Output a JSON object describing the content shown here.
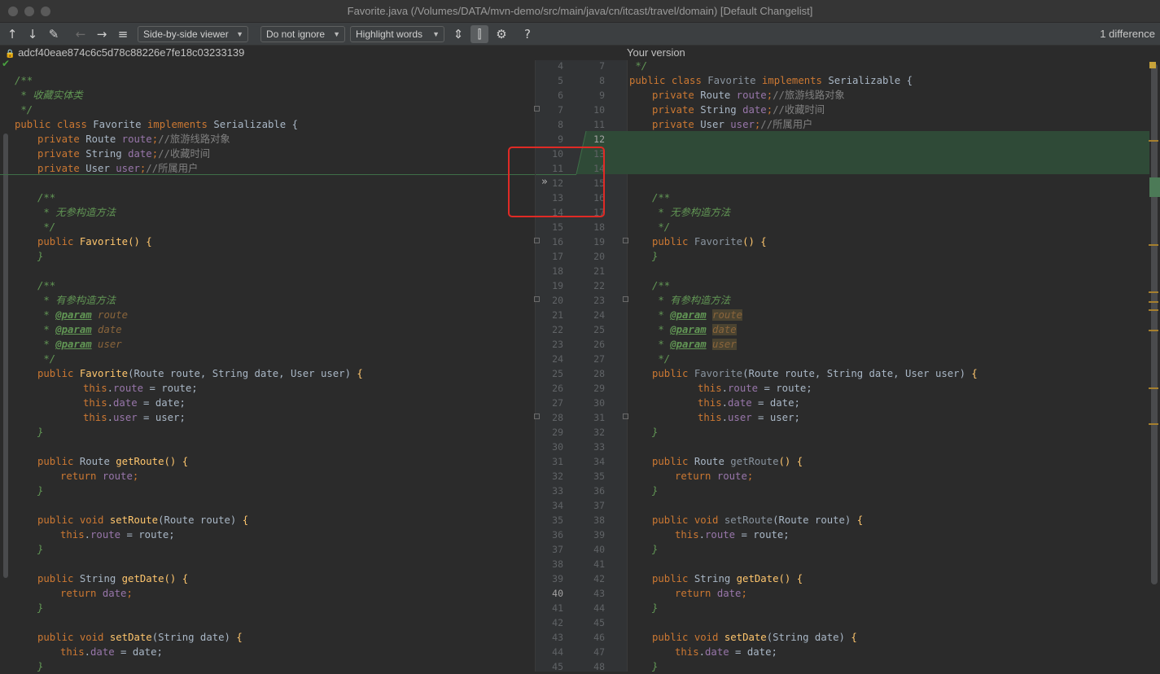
{
  "window": {
    "title": "Favorite.java (/Volumes/DATA/mvn-demo/src/main/java/cn/itcast/travel/domain) [Default Changelist]"
  },
  "toolbar": {
    "viewer_select": "Side-by-side viewer",
    "ignore_select": "Do not ignore",
    "highlight_select": "Highlight words",
    "help": "?",
    "difference_count": "1 difference"
  },
  "icons": [
    "arrow-up-icon",
    "arrow-down-icon",
    "edit-icon",
    "back-icon",
    "forward-icon",
    "list-icon",
    "collapse-icon",
    "sync-scroll-icon",
    "gear-icon",
    "lock-icon",
    "check-icon",
    "chevron-double-right-icon"
  ],
  "left_panel": {
    "header": "adcf40eae874c6c5d78c88226e7fe18c03233139"
  },
  "right_panel": {
    "header": "Your version"
  },
  "gutter": {
    "left": [
      "4",
      "5",
      "6",
      "7",
      "8",
      "9",
      "10",
      "11",
      "12",
      "13",
      "14",
      "15",
      "16",
      "17",
      "18",
      "19",
      "20",
      "21",
      "22",
      "23",
      "24",
      "25",
      "26",
      "27",
      "28",
      "29",
      "30",
      "31",
      "32",
      "33",
      "34",
      "35",
      "36",
      "37",
      "38",
      "39",
      "40",
      "41",
      "42",
      "43",
      "44",
      "45"
    ],
    "right": [
      "7",
      "8",
      "9",
      "10",
      "11",
      "12",
      "13",
      "14",
      "15",
      "16",
      "17",
      "18",
      "19",
      "20",
      "21",
      "22",
      "23",
      "24",
      "25",
      "26",
      "27",
      "28",
      "29",
      "30",
      "31",
      "32",
      "33",
      "34",
      "35",
      "36",
      "37",
      "38",
      "39",
      "40",
      "41",
      "42",
      "43",
      "44",
      "45",
      "46",
      "47",
      "48"
    ]
  },
  "code": {
    "kw_public": "public",
    "kw_class": "class",
    "kw_implements": "implements",
    "kw_private": "private",
    "kw_void": "void",
    "kw_this": "this",
    "kw_return": "return",
    "cls_favorite": "Favorite",
    "cls_serializable": "Serializable",
    "t_route": "Route",
    "t_string": "String",
    "t_user": "User",
    "f_route": "route",
    "f_date": "date",
    "f_user": "user",
    "c_open": "/**",
    "c_entity": " * 收藏实体类",
    "c_close": " */",
    "c_route": "//旅游线路对象",
    "c_date": "//收藏时间",
    "c_user": "//所属用户",
    "c_noarg": " * 无参构造方法",
    "c_arg": " * 有参构造方法",
    "c_star": " * ",
    "c_param": "@param",
    "m_getroute": "getRoute",
    "m_setroute": "setRoute",
    "m_getdate": "getDate",
    "m_setdate": "setDate",
    "p_empty": "()",
    "p_ctor_open": "(Route route, String date, User user)",
    "p_route_arg": "(Route route)",
    "p_string_arg": "(String date)",
    "brace_open": " {",
    "brace_close": "}",
    "semi": ";",
    "dot": ".",
    "assign_route": " = route;",
    "assign_date": " = date;",
    "assign_user": " = user;",
    "space": " "
  }
}
